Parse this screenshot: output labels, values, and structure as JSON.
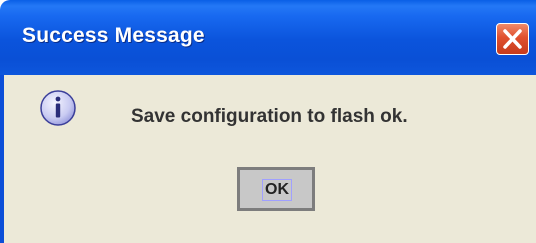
{
  "dialog": {
    "title": "Success Message",
    "message": "Save configuration to flash ok.",
    "ok_label": "OK",
    "icon": "info-icon",
    "close_icon": "close-icon"
  },
  "colors": {
    "titlebar": "#0a50d6",
    "content_background": "#ece9d8",
    "close_button": "#e0502e",
    "button_face": "#c8c8c8"
  }
}
